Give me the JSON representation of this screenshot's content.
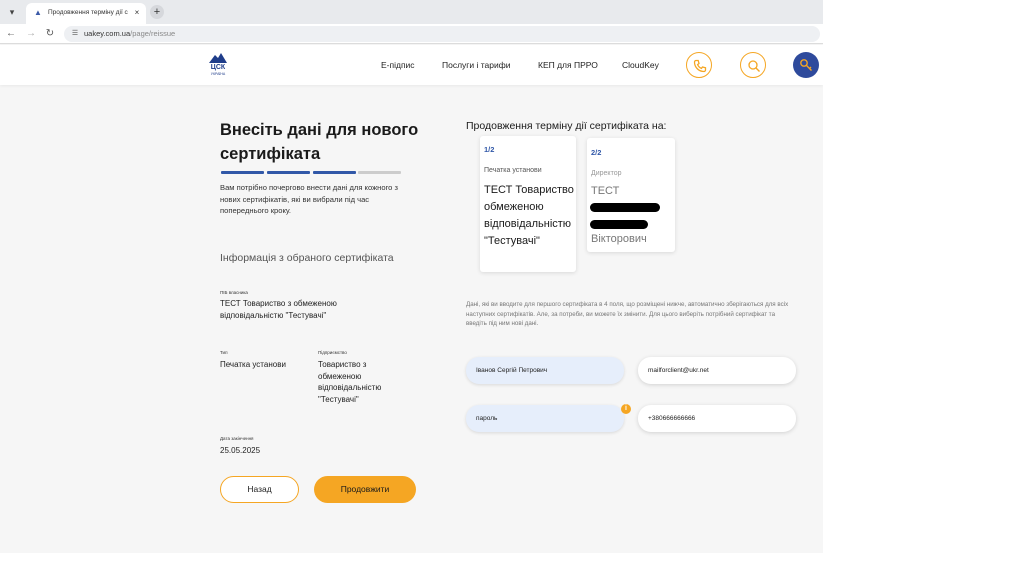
{
  "browser": {
    "tab_title": "Продовження терміну дії серт",
    "tab_close": "×",
    "new_tab": "+",
    "url_host": "uakey.com.ua",
    "url_path": "/page/reissue"
  },
  "header": {
    "logo_text": "ЦСК",
    "logo_sub": "УКРАЇНА",
    "nav": [
      "Е-підпис",
      "Послуги і тарифи",
      "КЕП для ПРРО",
      "CloudKey"
    ]
  },
  "left": {
    "heading": "Внесіть дані для нового сертифіката",
    "progress_steps_done": 3,
    "progress_steps_total": 4,
    "intro": "Вам потрібно почергово внести дані для кожного з нових сертифікатів, які ви вибрали під час попереднього кроку.",
    "section_title": "Інформація з обраного сертифіката",
    "owner_label": "ПІБ власника",
    "owner_value": "ТЕСТ Товариство з обмеженою відповідальністю \"Тестувачі\"",
    "type_label": "Тип",
    "type_value": "Печатка установи",
    "company_label": "Підприємство",
    "company_value": "Товариство з обмеженою відповідальністю \"Тестувачі\"",
    "expiry_label": "Дата закінчення",
    "expiry_value": "25.05.2025",
    "back_label": "Назад",
    "next_label": "Продовжити"
  },
  "right": {
    "title": "Продовження терміну дії сертифіката на:",
    "cards": [
      {
        "num": "1/2",
        "type": "Печатка установи",
        "name": "ТЕСТ Товариство з обмеженою відповідальністю \"Тестувачі\""
      },
      {
        "num": "2/2",
        "type": "Директор",
        "name_first": "ТЕСТ",
        "name_last": "Вікторович"
      }
    ],
    "hint": "Дані, які ви вводите для першого сертифіката в 4 поля, що розміщені нижче, автоматично зберігаються для всіх наступних сертифікатів. Але, за потреби, ви можете їх змінити. Для цього виберіть потрібний сертифікат та введіть під ним нові дані.",
    "inputs": {
      "name": "Іванов Сергій Петрович",
      "email": "mailforclient@ukr.net",
      "password": "пароль",
      "phone": "+380666666666"
    }
  },
  "colors": {
    "accent": "#f5a623",
    "brand": "#2e4a9c",
    "progress_done": "#3158a8",
    "progress_todo": "#cccccc"
  }
}
